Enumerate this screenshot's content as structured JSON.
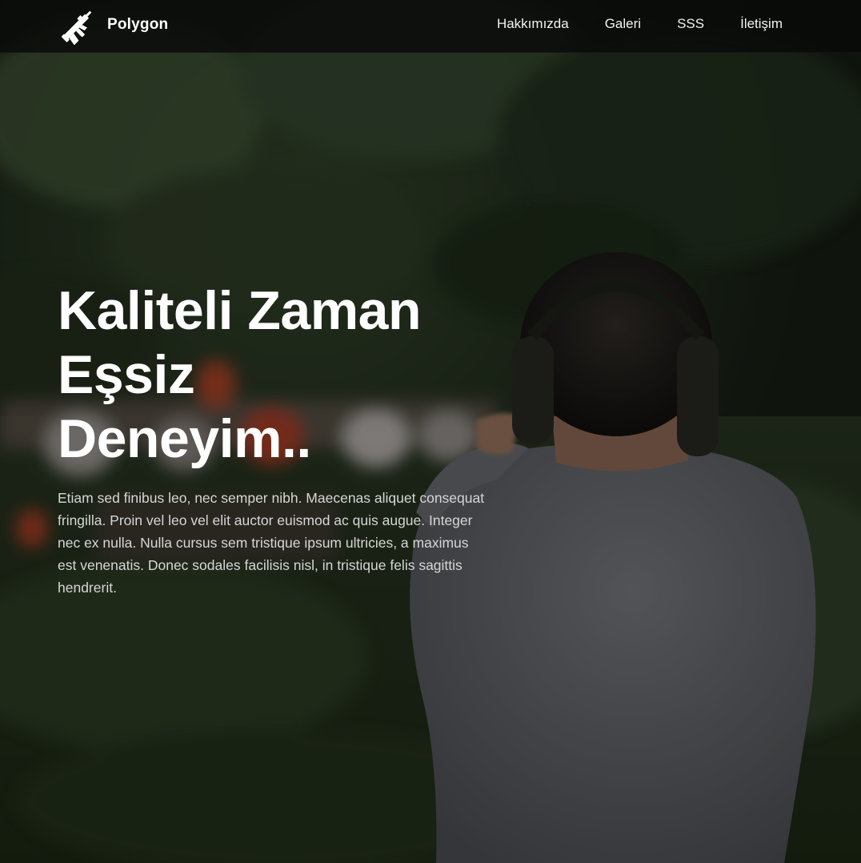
{
  "header": {
    "brand_name": "Polygon",
    "logo_icon": "rifle-icon",
    "nav": [
      {
        "label": "Hakkımızda"
      },
      {
        "label": "Galeri"
      },
      {
        "label": "SSS"
      },
      {
        "label": "İletişim"
      }
    ]
  },
  "hero": {
    "title_lines": [
      "Kaliteli Zaman",
      "Eşsiz",
      "Deneyim.."
    ],
    "description": "Etiam sed finibus leo, nec semper nibh. Maecenas aliquet consequat fringilla. Proin vel leo vel elit auctor euismod ac quis augue. Integer nec ex nulla. Nulla cursus sem tristique ipsum ultricies, a maximus est venenatis. Donec sodales facilisis nisl, in tristique felis sagittis hendrerit.",
    "background": "photo of a man wearing ear protection shooting at an outdoor range"
  },
  "colors": {
    "text_primary": "#ffffff",
    "text_secondary": "#d6d6d6",
    "navbar_bg": "#0a0c0a"
  }
}
